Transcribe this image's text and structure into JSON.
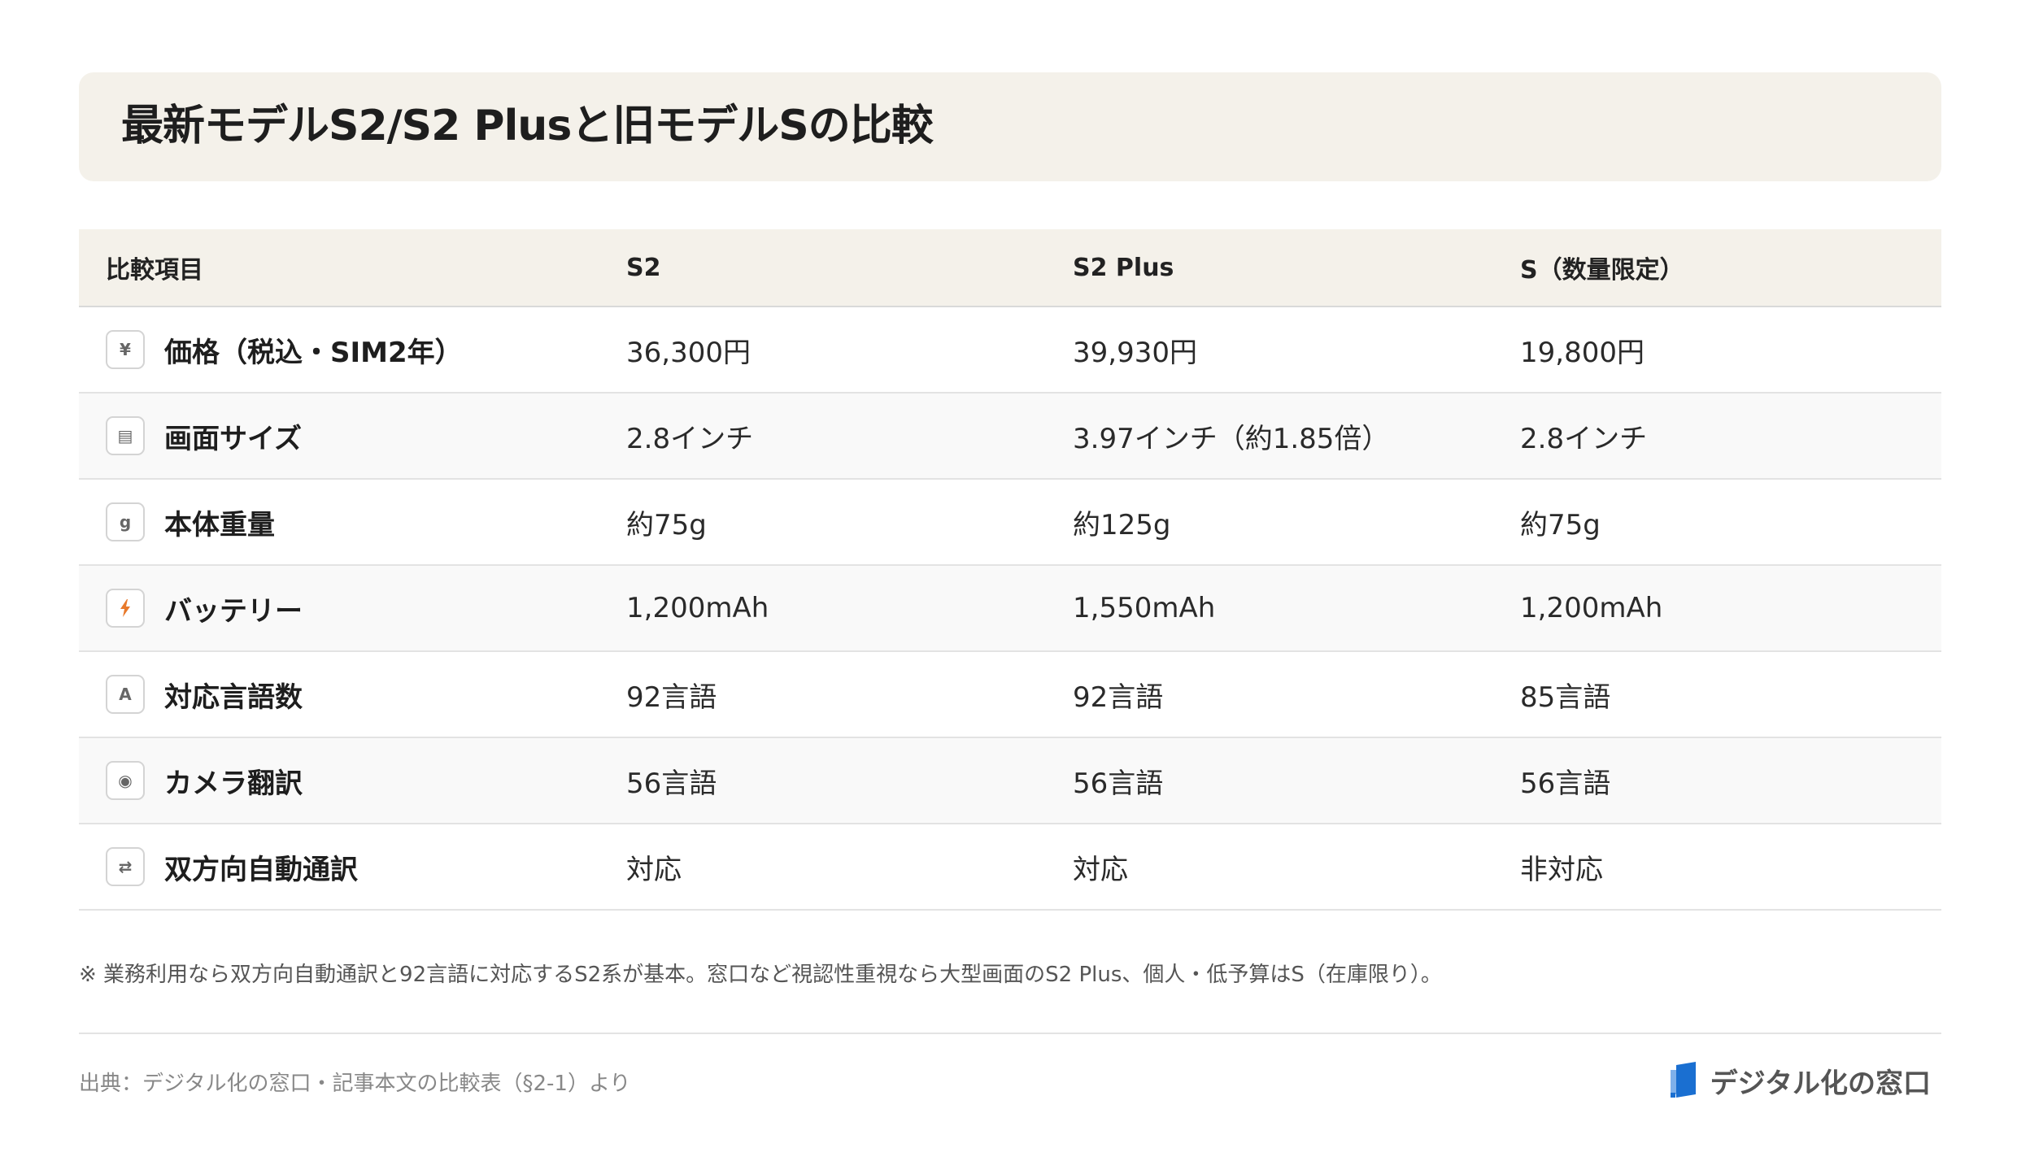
{
  "title": "最新モデルS2/S2 Plusと旧モデルSの比較",
  "table": {
    "headers": [
      "比較項目",
      "S2",
      "S2 Plus",
      "S（数量限定）"
    ],
    "rows": [
      {
        "icon_glyph": "¥",
        "icon": "yen-icon",
        "label": "価格（税込・SIM2年）",
        "s2": "36,300円",
        "s2plus": "39,930円",
        "s": "19,800円"
      },
      {
        "icon_glyph": "▤",
        "icon": "screen-icon",
        "label": "画面サイズ",
        "s2": "2.8インチ",
        "s2plus": "3.97インチ（約1.85倍）",
        "s": "2.8インチ"
      },
      {
        "icon_glyph": "g",
        "icon": "weight-icon",
        "label": "本体重量",
        "s2": "約75g",
        "s2plus": "約125g",
        "s": "約75g"
      },
      {
        "icon_glyph": "",
        "icon": "battery-bolt-icon",
        "label": "バッテリー",
        "s2": "1,200mAh",
        "s2plus": "1,550mAh",
        "s": "1,200mAh"
      },
      {
        "icon_glyph": "A",
        "icon": "language-icon",
        "label": "対応言語数",
        "s2": "92言語",
        "s2plus": "92言語",
        "s": "85言語"
      },
      {
        "icon_glyph": "◉",
        "icon": "camera-icon",
        "label": "カメラ翻訳",
        "s2": "56言語",
        "s2plus": "56言語",
        "s": "56言語"
      },
      {
        "icon_glyph": "⇄",
        "icon": "two-way-icon",
        "label": "双方向自動通訳",
        "s2": "対応",
        "s2plus": "対応",
        "s": "非対応"
      }
    ]
  },
  "note": "※ 業務利用なら双方向自動通訳と92言語に対応するS2系が基本。窓口など視認性重視なら大型画面のS2 Plus、個人・低予算はS（在庫限り）。",
  "source": "出典：デジタル化の窓口・記事本文の比較表（§2-1）より",
  "brand": {
    "name": "デジタル化の窓口",
    "logo_color": "#1a6fd1"
  },
  "colors": {
    "header_bg": "#f4f1ea",
    "bolt": "#e8792b"
  }
}
